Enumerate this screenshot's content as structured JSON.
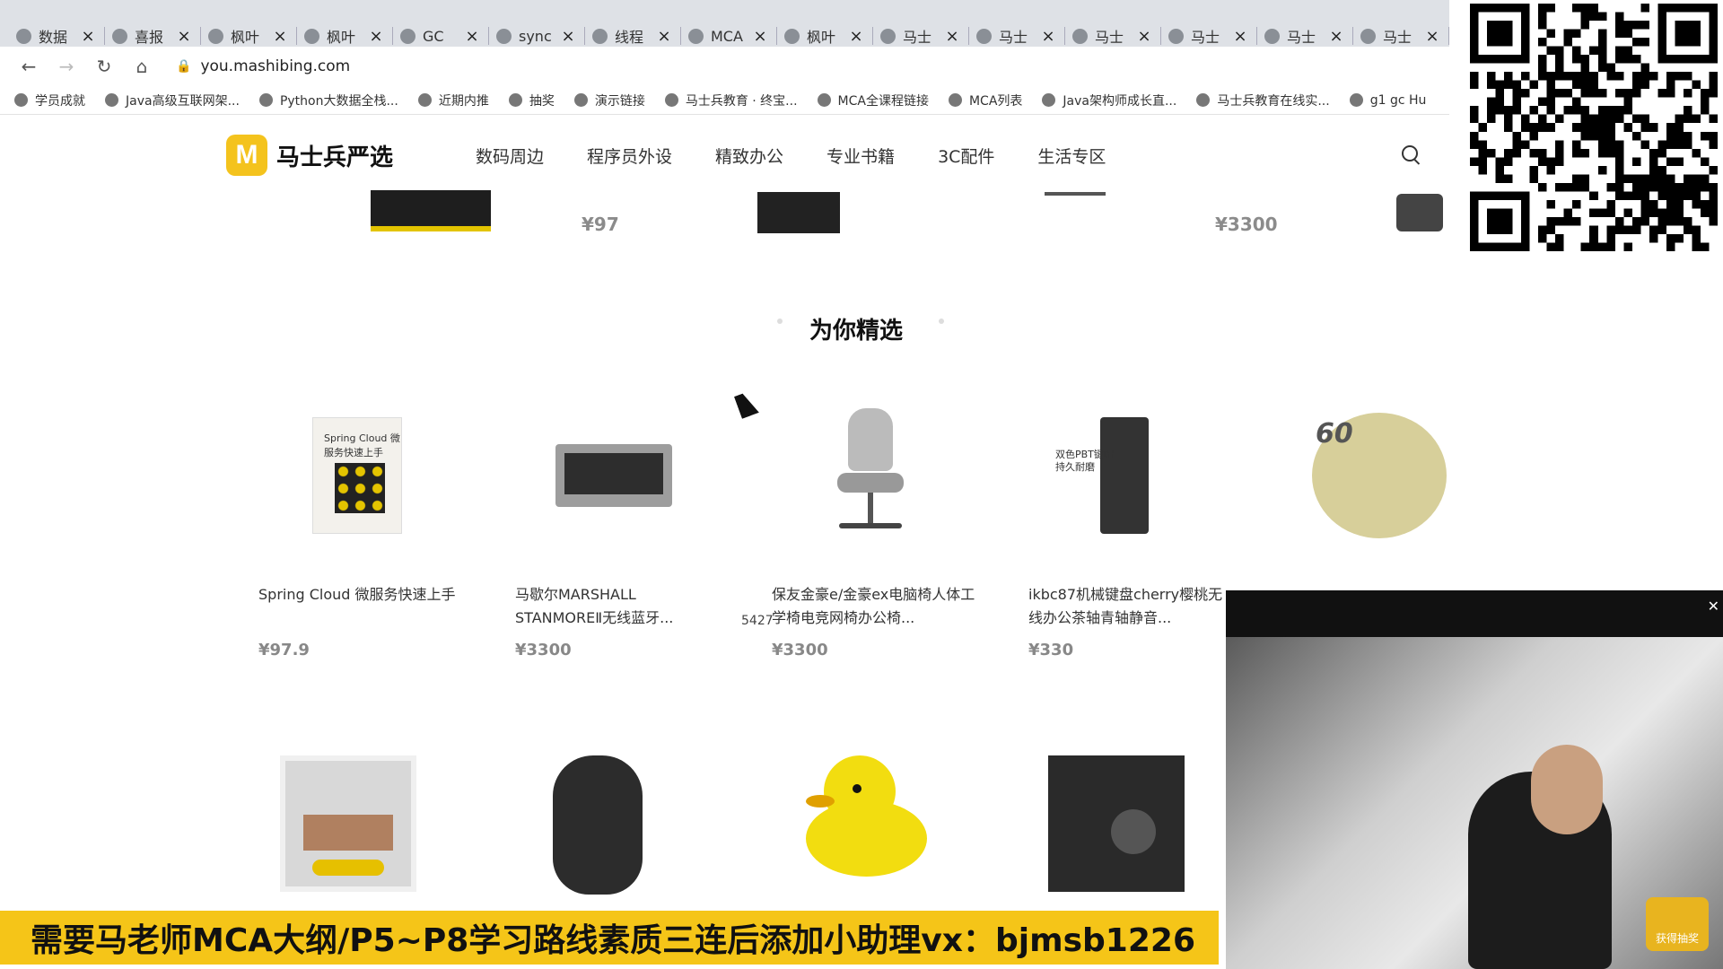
{
  "browser": {
    "tabs": [
      {
        "label": "数据"
      },
      {
        "label": "喜报"
      },
      {
        "label": "枫叶"
      },
      {
        "label": "枫叶"
      },
      {
        "label": "GC"
      },
      {
        "label": "sync"
      },
      {
        "label": "线程"
      },
      {
        "label": "MCA"
      },
      {
        "label": "枫叶"
      },
      {
        "label": "马士"
      },
      {
        "label": "马士"
      },
      {
        "label": "马士"
      },
      {
        "label": "马士"
      },
      {
        "label": "马士"
      },
      {
        "label": "马士"
      }
    ],
    "url": "you.mashibing.com",
    "bookmarks": [
      {
        "label": "学员成就"
      },
      {
        "label": "Java高级互联网架..."
      },
      {
        "label": "Python大数据全栈..."
      },
      {
        "label": "近期内推"
      },
      {
        "label": "抽奖"
      },
      {
        "label": "演示链接"
      },
      {
        "label": "马士兵教育 · 终宝..."
      },
      {
        "label": "MCA全课程链接"
      },
      {
        "label": "MCA列表"
      },
      {
        "label": "Java架构师成长直..."
      },
      {
        "label": "马士兵教育在线实..."
      },
      {
        "label": "g1 gc Hu"
      }
    ]
  },
  "site": {
    "logo_mark": "M",
    "logo_text": "马士兵严选",
    "menu": [
      {
        "label": "数码周边"
      },
      {
        "label": "程序员外设"
      },
      {
        "label": "精致办公"
      },
      {
        "label": "专业书籍"
      },
      {
        "label": "3C配件"
      },
      {
        "label": "生活专区"
      }
    ]
  },
  "top_strip": {
    "prices": [
      "¥97",
      "¥3300"
    ]
  },
  "section": {
    "title": "为你精选"
  },
  "products_row1": [
    {
      "name": "Spring Cloud 微服务快速上手",
      "price": "¥97.9",
      "cover_text": "Spring Cloud 微服务快速上手"
    },
    {
      "name": "马歇尔MARSHALL STANMOREⅡ无线蓝牙...",
      "price": "¥3300"
    },
    {
      "name": "保友金豪e/金豪ex电脑椅人体工学椅电竞网椅办公椅...",
      "price": "¥3300"
    },
    {
      "name": "ikbc87机械键盘cherry樱桃无线办公茶轴青轴静音...",
      "price": "¥330",
      "cover_text": "双色PBT键帽 持久耐磨"
    },
    {
      "name": "",
      "price": "",
      "cover_text": "60"
    }
  ],
  "overlay": {
    "watermark": "5427",
    "banner_text": "需要马老师MCA大纲/P5~P8学习路线素质三连后添加小助理vx：bjmsb1226",
    "video_badge": "获得抽奖"
  },
  "colors": {
    "brand": "#f4c31d",
    "banner": "#f5c518",
    "price": "#888888"
  }
}
